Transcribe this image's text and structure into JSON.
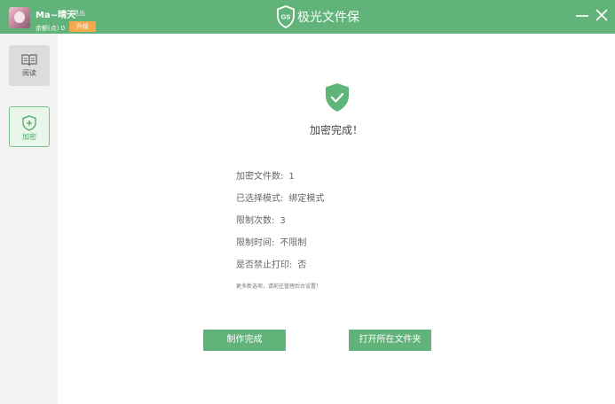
{
  "header": {
    "user_name": "Ma~晴天",
    "logout": "退出",
    "remaining": "余额(点) 0",
    "upgrade": "升级",
    "app_title": "极光文件保",
    "logo_text": "GS"
  },
  "sidebar": {
    "items": [
      {
        "label": "阅读",
        "icon": "book-icon"
      },
      {
        "label": "加密",
        "icon": "shield-plus-icon"
      }
    ]
  },
  "main": {
    "success_text": "加密完成！",
    "details": [
      {
        "label": "加密文件数:",
        "value": "1"
      },
      {
        "label": "已选择模式:",
        "value": "绑定模式"
      },
      {
        "label": "限制次数:",
        "value": "3"
      },
      {
        "label": "限制时间:",
        "value": "不限制"
      },
      {
        "label": "是否禁止打印:",
        "value": "否"
      }
    ],
    "note": "更多新选项，请前往管理后台设置！",
    "buttons": {
      "make_done": "制作完成",
      "open_folder": "打开所在文件夹"
    }
  },
  "colors": {
    "accent": "#62b37a",
    "badge": "#f5a94b"
  }
}
